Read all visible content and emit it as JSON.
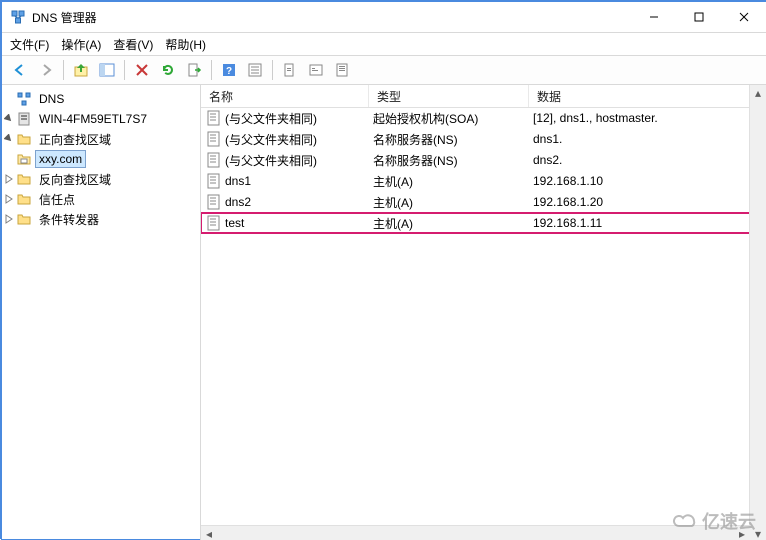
{
  "window": {
    "title": "DNS 管理器"
  },
  "menu": {
    "file": "文件(F)",
    "action": "操作(A)",
    "view": "查看(V)",
    "help": "帮助(H)"
  },
  "tree": {
    "root": "DNS",
    "server": "WIN-4FM59ETL7S7",
    "forward": "正向查找区域",
    "domain": "xxy.com",
    "reverse": "反向查找区域",
    "trust": "信任点",
    "conditional": "条件转发器"
  },
  "columns": {
    "name": "名称",
    "type": "类型",
    "data": "数据"
  },
  "records": [
    {
      "name": "(与父文件夹相同)",
      "type": "起始授权机构(SOA)",
      "data": "[12], dns1., hostmaster.",
      "highlight": false
    },
    {
      "name": "(与父文件夹相同)",
      "type": "名称服务器(NS)",
      "data": "dns1.",
      "highlight": false
    },
    {
      "name": "(与父文件夹相同)",
      "type": "名称服务器(NS)",
      "data": "dns2.",
      "highlight": false
    },
    {
      "name": "dns1",
      "type": "主机(A)",
      "data": "192.168.1.10",
      "highlight": false
    },
    {
      "name": "dns2",
      "type": "主机(A)",
      "data": "192.168.1.20",
      "highlight": false
    },
    {
      "name": "test",
      "type": "主机(A)",
      "data": "192.168.1.11",
      "highlight": true
    }
  ],
  "watermark": "亿速云"
}
